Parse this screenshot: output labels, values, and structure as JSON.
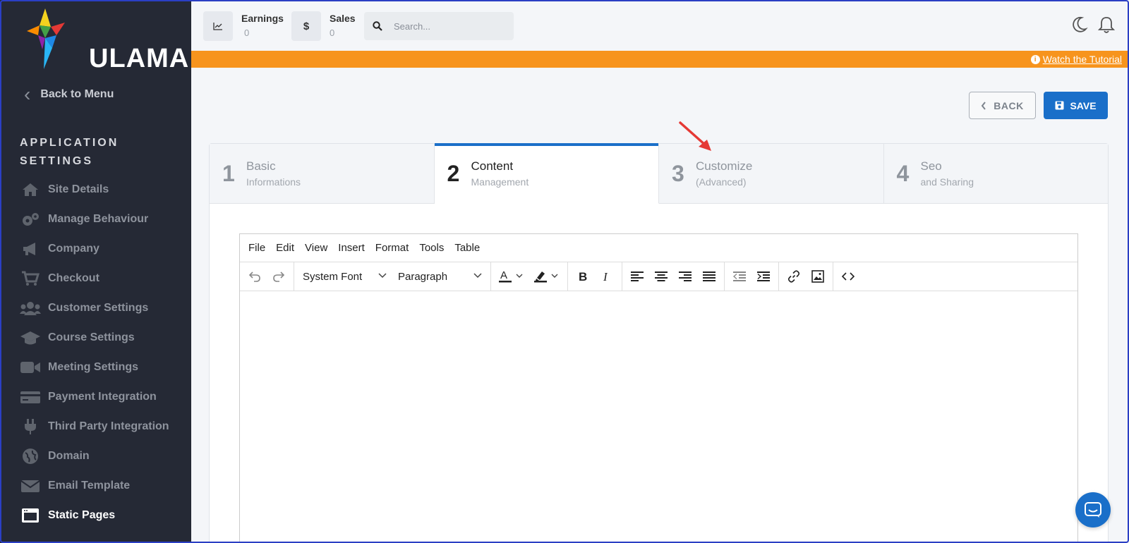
{
  "brand": {
    "name": "ULAMA"
  },
  "sidebar": {
    "back_label": "Back to Menu",
    "section_title": "APPLICATION SETTINGS",
    "items": [
      {
        "label": "Site Details",
        "icon": "home-icon"
      },
      {
        "label": "Manage Behaviour",
        "icon": "gears-icon"
      },
      {
        "label": "Company",
        "icon": "megaphone-icon"
      },
      {
        "label": "Checkout",
        "icon": "cart-icon"
      },
      {
        "label": "Customer Settings",
        "icon": "users-icon"
      },
      {
        "label": "Course Settings",
        "icon": "graduation-cap-icon"
      },
      {
        "label": "Meeting Settings",
        "icon": "video-icon"
      },
      {
        "label": "Payment Integration",
        "icon": "credit-card-icon"
      },
      {
        "label": "Third Party Integration",
        "icon": "plug-icon"
      },
      {
        "label": "Domain",
        "icon": "globe-icon"
      },
      {
        "label": "Email Template",
        "icon": "envelope-icon"
      },
      {
        "label": "Static Pages",
        "icon": "window-icon",
        "active": true
      }
    ]
  },
  "topbar": {
    "earnings_label": "Earnings",
    "earnings_value": "0",
    "sales_label": "Sales",
    "sales_value": "0",
    "sales_symbol": "$",
    "search_placeholder": "Search..."
  },
  "banner": {
    "link_label": "Watch the Tutorial"
  },
  "actions": {
    "back_label": "BACK",
    "save_label": "SAVE"
  },
  "steps": [
    {
      "num": "1",
      "title": "Basic",
      "sub": "Informations"
    },
    {
      "num": "2",
      "title": "Content",
      "sub": "Management",
      "active": true
    },
    {
      "num": "3",
      "title": "Customize",
      "sub": "(Advanced)"
    },
    {
      "num": "4",
      "title": "Seo",
      "sub": "and Sharing"
    }
  ],
  "editor": {
    "menu": [
      "File",
      "Edit",
      "View",
      "Insert",
      "Format",
      "Tools",
      "Table"
    ],
    "font_select": "System Font",
    "block_select": "Paragraph"
  },
  "colors": {
    "accent": "#1a6fc9",
    "banner": "#f7941d",
    "sidebar": "#252935",
    "annotation": "#e53935"
  }
}
